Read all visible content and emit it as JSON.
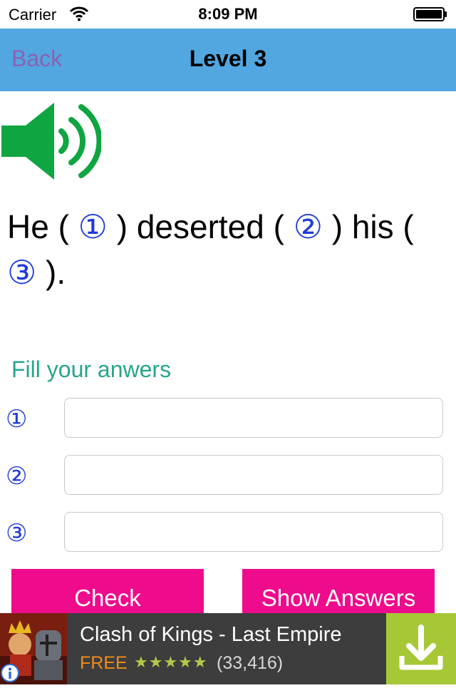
{
  "status": {
    "carrier": "Carrier",
    "time": "8:09 PM"
  },
  "nav": {
    "back_label": "Back",
    "title": "Level 3",
    "background": "#52a7e0"
  },
  "sentence": {
    "part1": "He (",
    "blank1": " ① ",
    "part2": " ) deserted (",
    "blank2": " ② ",
    "part3": " ) his (",
    "blank3": " ③ ",
    "part4": " )."
  },
  "form": {
    "label": "Fill your anwers",
    "answers": [
      {
        "marker": "①",
        "value": ""
      },
      {
        "marker": "②",
        "value": ""
      },
      {
        "marker": "③",
        "value": ""
      }
    ],
    "check_label": "Check",
    "show_answers_label": "Show Answers",
    "button_color": "#ee0b8c"
  },
  "ad": {
    "title": "Clash of Kings - Last Empire",
    "price": "FREE",
    "stars": "★★★★★",
    "rating": 4.5,
    "reviews": "(33,416)",
    "download_color": "#a6c836"
  }
}
